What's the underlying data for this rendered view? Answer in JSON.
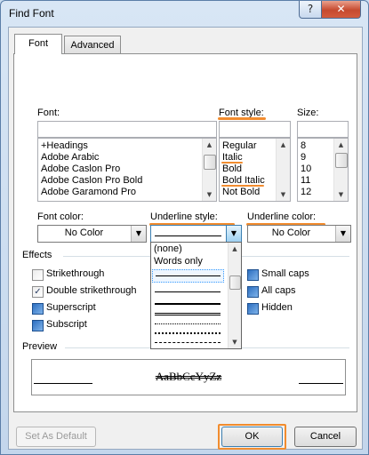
{
  "window": {
    "title": "Find Font"
  },
  "titlebar": {
    "help_glyph": "?",
    "close_glyph": "✕"
  },
  "tabs": [
    {
      "label": "Font",
      "active": true
    },
    {
      "label": "Advanced",
      "active": false
    }
  ],
  "font": {
    "label": "Font:",
    "value": "",
    "items": [
      "+Headings",
      "Adobe Arabic",
      "Adobe Caslon Pro",
      "Adobe Caslon Pro Bold",
      "Adobe Garamond Pro"
    ]
  },
  "font_style": {
    "label": "Font style:",
    "value": "",
    "items": [
      "Regular",
      "Italic",
      "Bold",
      "Bold Italic",
      "Not Bold"
    ]
  },
  "size": {
    "label": "Size:",
    "value": "",
    "items": [
      "8",
      "9",
      "10",
      "11",
      "12"
    ]
  },
  "font_color": {
    "label": "Font color:",
    "value": "No Color"
  },
  "underline_style": {
    "label": "Underline style:",
    "items": [
      "(none)",
      "Words only"
    ]
  },
  "underline_color": {
    "label": "Underline color:",
    "value": "No Color"
  },
  "effects": {
    "label": "Effects",
    "items": [
      {
        "label": "Strikethrough",
        "checked": false,
        "style": "empty"
      },
      {
        "label": "Double strikethrough",
        "checked": true,
        "style": "check"
      },
      {
        "label": "Superscript",
        "checked": false,
        "style": "blue"
      },
      {
        "label": "Subscript",
        "checked": false,
        "style": "blue"
      },
      {
        "label": "Small caps",
        "checked": false,
        "style": "blue"
      },
      {
        "label": "All caps",
        "checked": false,
        "style": "blue"
      },
      {
        "label": "Hidden",
        "checked": false,
        "style": "blue"
      }
    ]
  },
  "preview": {
    "label": "Preview",
    "sample": "AaBbCcYyZz"
  },
  "buttons": {
    "set_default": "Set As Default",
    "ok": "OK",
    "cancel": "Cancel"
  },
  "colors": {
    "highlight": "#f28c2e",
    "dropdown_selected": "#3399ff",
    "frame": "#5b7ea8"
  }
}
